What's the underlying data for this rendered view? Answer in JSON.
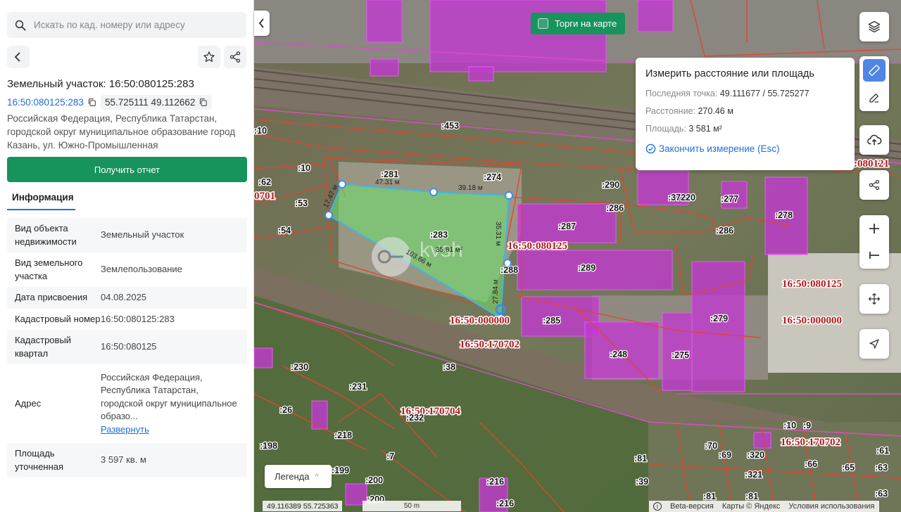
{
  "search": {
    "placeholder": "Искать по кад. номеру или адресу"
  },
  "parcel": {
    "title": "Земельный участок: 16:50:080125:283",
    "kad_number": "16:50:080125:283",
    "coords": "55.725111 49.112662",
    "address": "Российская Федерация, Республика Татарстан, городской округ муниципальное образование город Казань, ул. Южно-Промышленная",
    "report_label": "Получить отчет",
    "tab_label": "Информация"
  },
  "info_rows": [
    {
      "key": "Вид объекта недвижимости",
      "value": "Земельный участок"
    },
    {
      "key": "Вид земельного участка",
      "value": "Землепользование"
    },
    {
      "key": "Дата присвоения",
      "value": "04.08.2025"
    },
    {
      "key": "Кадастровый номер",
      "value": "16:50:080125:283"
    },
    {
      "key": "Кадастровый квартал",
      "value": "16:50:080125"
    },
    {
      "key": "Адрес",
      "value": "Российская Федерация, Республика Татарстан, городской округ муниципальное образо...",
      "link": "Развернуть"
    },
    {
      "key": "Площадь уточненная",
      "value": "3 597 кв. м"
    }
  ],
  "map": {
    "torgi_label": "Торги на карте",
    "measure": {
      "title": "Измерить расстояние или площадь",
      "last_point_label": "Последняя точка:",
      "last_point_value": "49.111677 / 55.725277",
      "distance_label": "Расстояние:",
      "distance_value": "270.46 м",
      "area_label": "Площадь:",
      "area_value": "3 581 м²",
      "finish_label": "Закончить измерение (Esc)"
    },
    "legend_label": "Легенда",
    "cursor_coords": "49.116389  55.725363",
    "scale_label": "50 m",
    "beta_label": "Beta-версия",
    "attribution": "Карты © Яндекс",
    "terms": "Условия использования",
    "watermark": "kvsh",
    "segment_labels": [
      "47.31 м",
      "39.18 м",
      "35.31 м",
      "27.84 м",
      "103.66 м",
      "17.47 м",
      "35.81 м²"
    ],
    "quarter_labels": [
      "16:50:080125",
      "16:50:000000",
      "16:50:170702",
      "16:50:170704",
      "16:50:080125",
      "16:50:000000",
      "16:50:170702",
      ":080121",
      "0701"
    ],
    "lot_labels": [
      ":453",
      ":281",
      ":274",
      ":290",
      ":286",
      ":287",
      ":289",
      ":288",
      ":285",
      ":248",
      ":275",
      ":279",
      ":278",
      ":277",
      ":37220",
      ":286",
      ":283",
      ":10",
      ":62",
      ":53",
      ":54",
      ":10",
      ":230",
      ":38",
      ":231",
      ":26",
      ":232",
      ":218",
      ":198",
      ":7",
      ":199",
      ":200",
      ":200",
      ":216",
      ":216",
      ":81",
      ":39",
      ":10",
      ":9",
      ":70",
      ":69",
      ":320",
      ":66",
      ":65",
      ":63",
      ":321",
      ":81",
      ":81",
      ":63",
      ":61"
    ]
  },
  "colors": {
    "green": "#17935c",
    "blue": "#1d6fd6",
    "purple": "#c040d0",
    "red": "#d23a2a"
  }
}
